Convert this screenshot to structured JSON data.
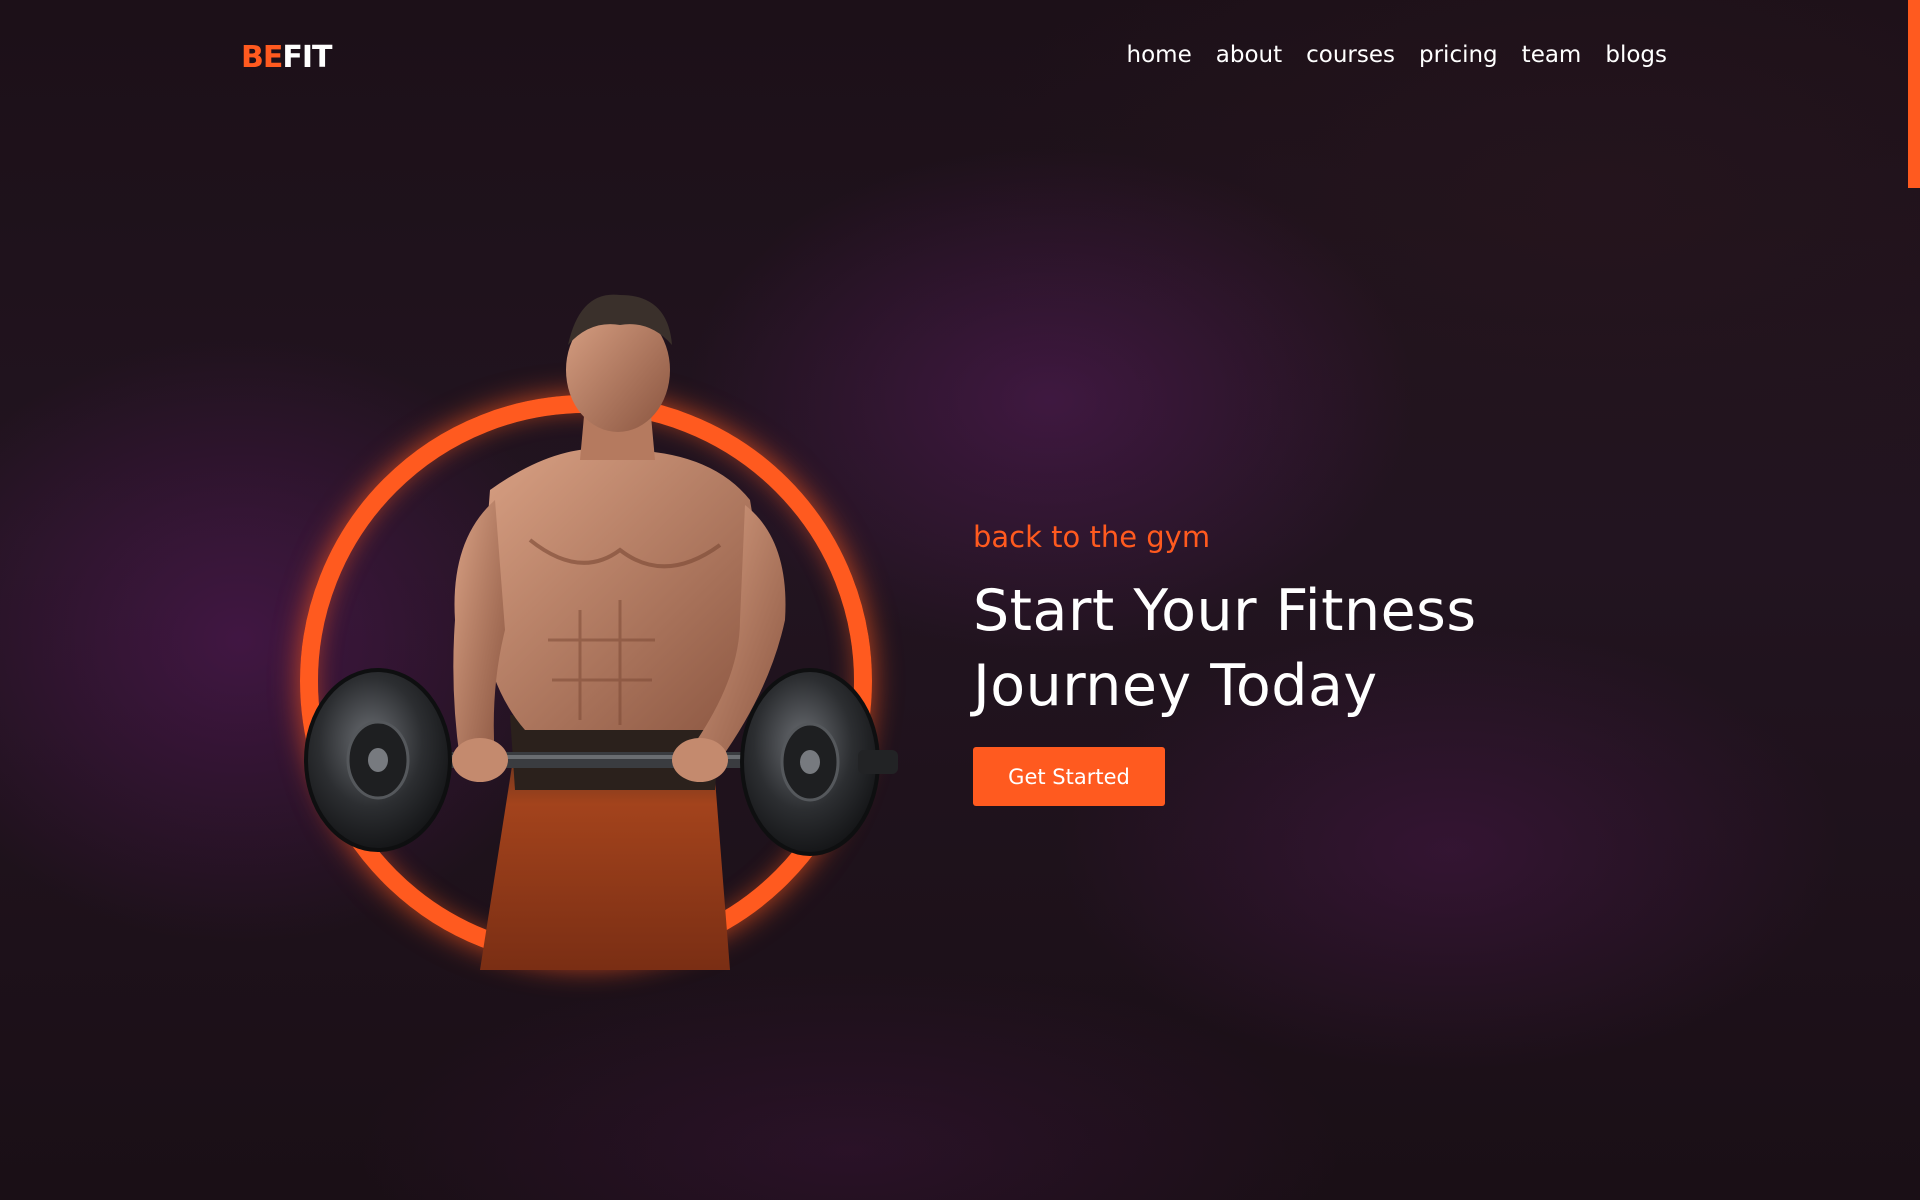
{
  "brand": {
    "logo_part_1": "BE",
    "logo_part_2": "FIT",
    "accent_color": "#ff5a1f"
  },
  "nav": {
    "items": [
      {
        "label": "home"
      },
      {
        "label": "about"
      },
      {
        "label": "courses"
      },
      {
        "label": "pricing"
      },
      {
        "label": "team"
      },
      {
        "label": "blogs"
      }
    ]
  },
  "hero": {
    "eyebrow": "back to the gym",
    "headline_line_1": "Start Your Fitness",
    "headline_line_2": "Journey Today",
    "cta_label": "Get Started",
    "image": "athlete-with-barbell-in-orange-ring"
  }
}
